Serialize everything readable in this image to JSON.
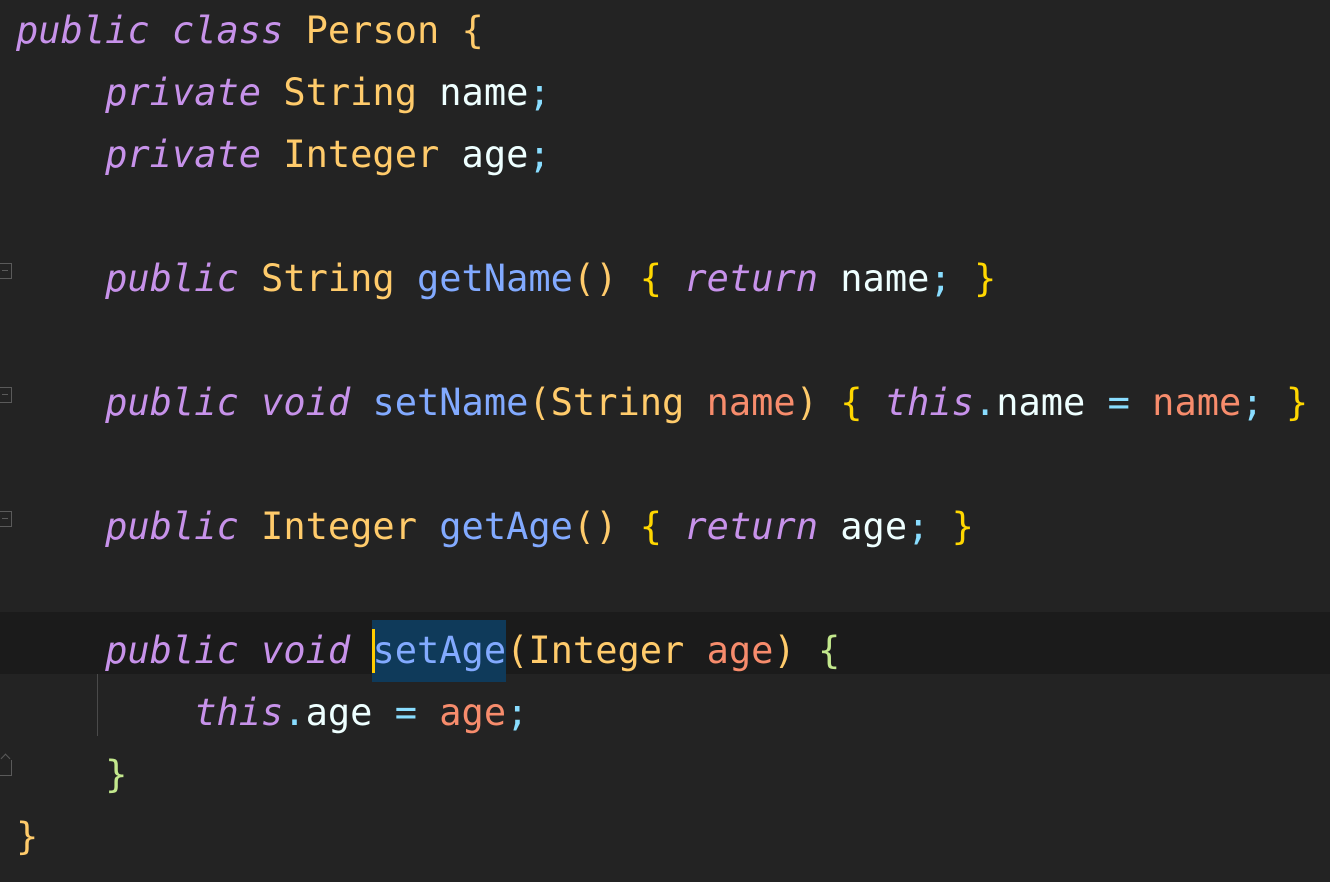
{
  "editor": {
    "language": "Java",
    "theme_colors": {
      "background": "#232323",
      "current_line": "#1b1b1b",
      "keyword": "#c792ea",
      "type": "#ffcb6b",
      "function": "#82aaff",
      "variable": "#eeffff",
      "parameter": "#f78c6c",
      "punctuation": "#89ddff",
      "brace": "#ffd700",
      "cursor": "#ffcc00",
      "selection": "#0f3a5a"
    },
    "lines": [
      {
        "tokens": [
          {
            "t": "public",
            "c": "kw"
          },
          {
            "t": " ",
            "c": "var"
          },
          {
            "t": "class",
            "c": "kw"
          },
          {
            "t": " ",
            "c": "var"
          },
          {
            "t": "Person",
            "c": "type"
          },
          {
            "t": " ",
            "c": "var"
          },
          {
            "t": "{",
            "c": "classbrace"
          }
        ]
      },
      {
        "tokens": [
          {
            "t": "    ",
            "c": "var"
          },
          {
            "t": "private",
            "c": "kw"
          },
          {
            "t": " ",
            "c": "var"
          },
          {
            "t": "String",
            "c": "type"
          },
          {
            "t": " ",
            "c": "var"
          },
          {
            "t": "name",
            "c": "var"
          },
          {
            "t": ";",
            "c": "punct"
          }
        ]
      },
      {
        "tokens": [
          {
            "t": "    ",
            "c": "var"
          },
          {
            "t": "private",
            "c": "kw"
          },
          {
            "t": " ",
            "c": "var"
          },
          {
            "t": "Integer",
            "c": "type"
          },
          {
            "t": " ",
            "c": "var"
          },
          {
            "t": "age",
            "c": "var"
          },
          {
            "t": ";",
            "c": "punct"
          }
        ]
      },
      {
        "tokens": []
      },
      {
        "tokens": [
          {
            "t": "    ",
            "c": "var"
          },
          {
            "t": "public",
            "c": "kw"
          },
          {
            "t": " ",
            "c": "var"
          },
          {
            "t": "String",
            "c": "type"
          },
          {
            "t": " ",
            "c": "var"
          },
          {
            "t": "getName",
            "c": "fn"
          },
          {
            "t": "()",
            "c": "type"
          },
          {
            "t": " ",
            "c": "var"
          },
          {
            "t": "{",
            "c": "brace"
          },
          {
            "t": " ",
            "c": "var"
          },
          {
            "t": "return",
            "c": "kw"
          },
          {
            "t": " ",
            "c": "var"
          },
          {
            "t": "name",
            "c": "var"
          },
          {
            "t": ";",
            "c": "punct"
          },
          {
            "t": " ",
            "c": "var"
          },
          {
            "t": "}",
            "c": "brace"
          }
        ]
      },
      {
        "tokens": []
      },
      {
        "tokens": [
          {
            "t": "    ",
            "c": "var"
          },
          {
            "t": "public",
            "c": "kw"
          },
          {
            "t": " ",
            "c": "var"
          },
          {
            "t": "void",
            "c": "kw"
          },
          {
            "t": " ",
            "c": "var"
          },
          {
            "t": "setName",
            "c": "fn"
          },
          {
            "t": "(",
            "c": "type"
          },
          {
            "t": "String",
            "c": "type"
          },
          {
            "t": " ",
            "c": "var"
          },
          {
            "t": "name",
            "c": "param"
          },
          {
            "t": ")",
            "c": "type"
          },
          {
            "t": " ",
            "c": "var"
          },
          {
            "t": "{",
            "c": "brace"
          },
          {
            "t": " ",
            "c": "var"
          },
          {
            "t": "this",
            "c": "kw"
          },
          {
            "t": ".",
            "c": "punct"
          },
          {
            "t": "name",
            "c": "var"
          },
          {
            "t": " ",
            "c": "var"
          },
          {
            "t": "=",
            "c": "punct"
          },
          {
            "t": " ",
            "c": "var"
          },
          {
            "t": "name",
            "c": "param"
          },
          {
            "t": ";",
            "c": "punct"
          },
          {
            "t": " ",
            "c": "var"
          },
          {
            "t": "}",
            "c": "brace"
          }
        ]
      },
      {
        "tokens": []
      },
      {
        "tokens": [
          {
            "t": "    ",
            "c": "var"
          },
          {
            "t": "public",
            "c": "kw"
          },
          {
            "t": " ",
            "c": "var"
          },
          {
            "t": "Integer",
            "c": "type"
          },
          {
            "t": " ",
            "c": "var"
          },
          {
            "t": "getAge",
            "c": "fn"
          },
          {
            "t": "()",
            "c": "type"
          },
          {
            "t": " ",
            "c": "var"
          },
          {
            "t": "{",
            "c": "brace"
          },
          {
            "t": " ",
            "c": "var"
          },
          {
            "t": "return",
            "c": "kw"
          },
          {
            "t": " ",
            "c": "var"
          },
          {
            "t": "age",
            "c": "var"
          },
          {
            "t": ";",
            "c": "punct"
          },
          {
            "t": " ",
            "c": "var"
          },
          {
            "t": "}",
            "c": "brace"
          }
        ]
      },
      {
        "tokens": []
      },
      {
        "current": true,
        "tokens": [
          {
            "t": "    ",
            "c": "var"
          },
          {
            "t": "public",
            "c": "kw"
          },
          {
            "t": " ",
            "c": "var"
          },
          {
            "t": "void",
            "c": "kw"
          },
          {
            "t": " ",
            "c": "var"
          },
          {
            "t": "setAge",
            "c": "fn",
            "selected": true,
            "cursor": true
          },
          {
            "t": "(",
            "c": "type"
          },
          {
            "t": "Integer",
            "c": "type"
          },
          {
            "t": " ",
            "c": "var"
          },
          {
            "t": "age",
            "c": "param"
          },
          {
            "t": ")",
            "c": "type"
          },
          {
            "t": " ",
            "c": "var"
          },
          {
            "t": "{",
            "c": "brace2"
          }
        ]
      },
      {
        "tokens": [
          {
            "t": "        ",
            "c": "var"
          },
          {
            "t": "this",
            "c": "kw"
          },
          {
            "t": ".",
            "c": "punct"
          },
          {
            "t": "age",
            "c": "var"
          },
          {
            "t": " ",
            "c": "var"
          },
          {
            "t": "=",
            "c": "punct"
          },
          {
            "t": " ",
            "c": "var"
          },
          {
            "t": "age",
            "c": "param"
          },
          {
            "t": ";",
            "c": "punct"
          }
        ]
      },
      {
        "tokens": [
          {
            "t": "    ",
            "c": "var"
          },
          {
            "t": "}",
            "c": "brace2"
          }
        ]
      },
      {
        "tokens": [
          {
            "t": "}",
            "c": "classbrace"
          }
        ]
      }
    ]
  }
}
